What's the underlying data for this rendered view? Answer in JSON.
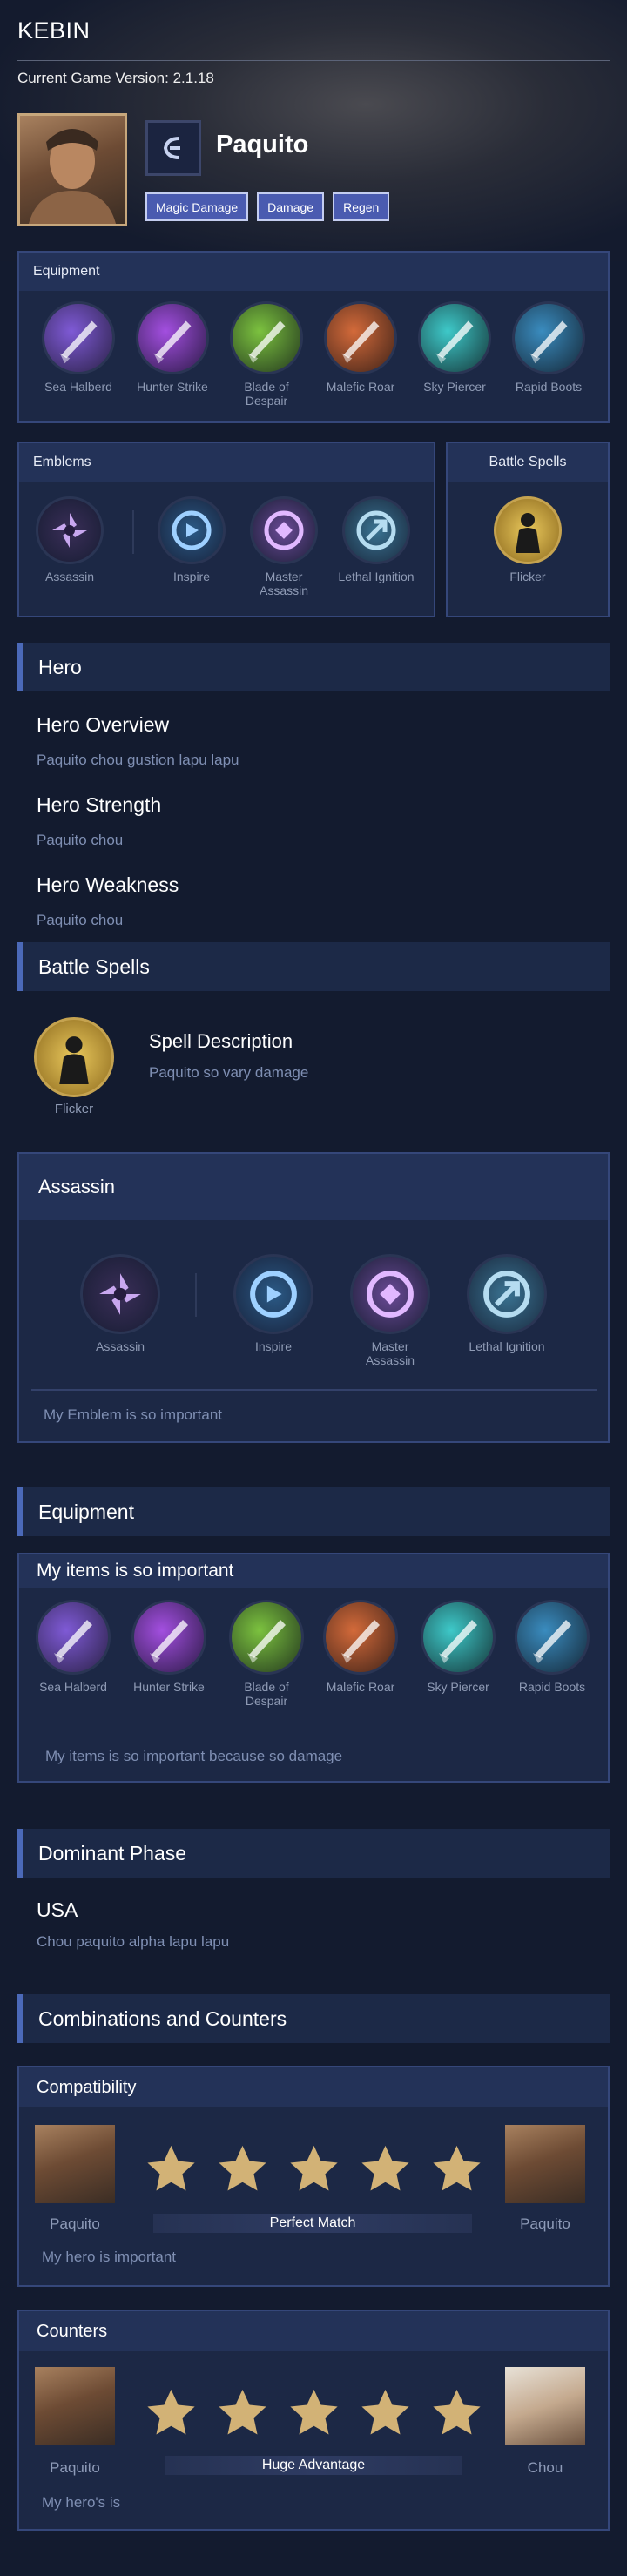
{
  "app": {
    "title": "KEBIN",
    "version": "Current Game Version: 2.1.18"
  },
  "hero": {
    "name": "Paquito",
    "tags": [
      "Magic Damage",
      "Damage",
      "Regen"
    ]
  },
  "equipment_panel": {
    "title": "Equipment",
    "items": [
      "Sea Halberd",
      "Hunter Strike",
      "Blade of Despair",
      "Malefic Roar",
      "Sky Piercer",
      "Rapid Boots"
    ]
  },
  "emblems_panel": {
    "title": "Emblems",
    "main": "Assassin",
    "talents": [
      "Inspire",
      "Master Assassin",
      "Lethal Ignition"
    ]
  },
  "spells_panel": {
    "title": "Battle Spells",
    "spell": "Flicker"
  },
  "hero_section": {
    "title": "Hero",
    "overview_title": "Hero Overview",
    "overview_text": "Paquito chou gustion lapu lapu",
    "strength_title": "Hero Strength",
    "strength_text": "Paquito chou",
    "weakness_title": "Hero Weakness",
    "weakness_text": "Paquito chou"
  },
  "battle_spells_section": {
    "title": "Battle Spells",
    "spell": "Flicker",
    "desc_title": "Spell Description",
    "desc_text": "Paquito so vary damage"
  },
  "emblem_section": {
    "title": "Assassin",
    "main": "Assassin",
    "talents": [
      "Inspire",
      "Master Assassin",
      "Lethal Ignition"
    ],
    "note": "My Emblem is so important"
  },
  "equipment_section": {
    "title": "Equipment",
    "box_title": "My items is so important",
    "items": [
      "Sea Halberd",
      "Hunter Strike",
      "Blade of Despair",
      "Malefic Roar",
      "Sky Piercer",
      "Rapid Boots"
    ],
    "note": "My items is so important because so damage"
  },
  "dominant_phase": {
    "title": "Dominant Phase",
    "phase": "USA",
    "text": "Chou paquito alpha lapu lapu"
  },
  "combos": {
    "title": "Combinations and Counters",
    "compat": {
      "title": "Compatibility",
      "left": "Paquito",
      "right": "Paquito",
      "rating": 5,
      "label": "Perfect Match",
      "note": "My hero is important"
    },
    "counters": {
      "title": "Counters",
      "left": "Paquito",
      "right": "Chou",
      "rating": 5,
      "label": "Huge Advantage",
      "note": "My hero's is"
    }
  },
  "colors": {
    "accent": "#4b69b8",
    "background": "#131b2f",
    "panel": "#1c2845",
    "tag": "#4a5bb0",
    "star": "#d2b276"
  }
}
